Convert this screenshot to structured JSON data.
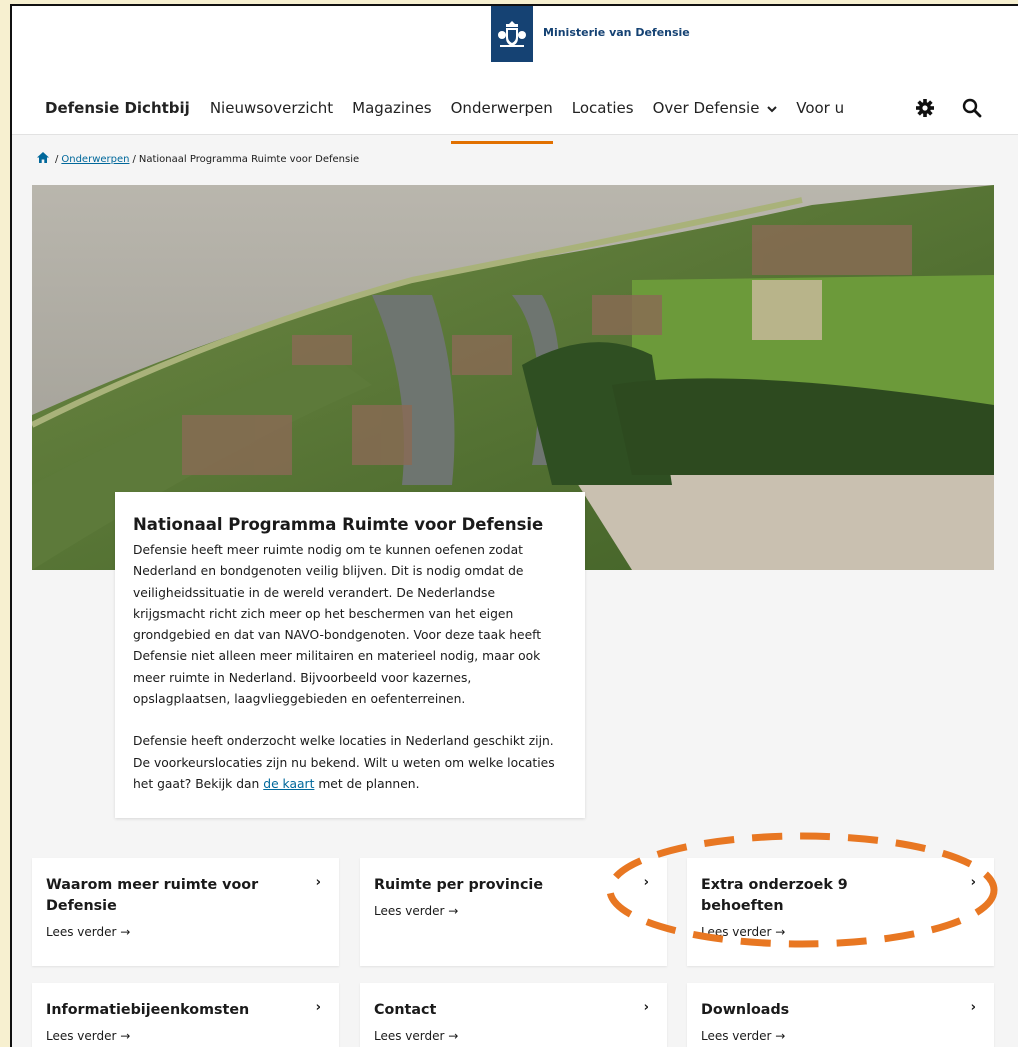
{
  "header": {
    "ministry": "Ministerie van Defensie",
    "nav": {
      "brand": "Defensie Dichtbij",
      "items": [
        "Nieuwsoverzicht",
        "Magazines",
        "Onderwerpen",
        "Locaties",
        "Over Defensie",
        "Voor u"
      ],
      "active": "Onderwerpen"
    },
    "icons": [
      "gear-icon",
      "search-icon",
      "chevron-down-icon"
    ]
  },
  "breadcrumb": {
    "home_icon": "home-icon",
    "link": "Onderwerpen",
    "current": "Nationaal Programma Ruimte voor Defensie",
    "separator": "/"
  },
  "intro": {
    "title": "Nationaal Programma Ruimte voor Defensie",
    "p1": "Defensie heeft meer ruimte nodig om te kunnen oefenen zodat Nederland en bondgenoten veilig blijven. Dit is nodig omdat de veiligheidssituatie in de wereld verandert. De Nederlandse krijgsmacht richt zich meer op het beschermen van het eigen grondgebied en dat van NAVO-bondgenoten. Voor deze taak heeft Defensie niet alleen meer militairen en materieel nodig, maar ook meer ruimte in Nederland. Bijvoorbeeld voor kazernes, opslagplaatsen, laagvlieggebieden en oefenterreinen.",
    "p2_before": "Defensie heeft onderzocht welke locaties in Nederland geschikt zijn. De voorkeurslocaties zijn nu bekend. Wilt u weten om welke locaties het gaat? Bekijk dan ",
    "p2_link": "de kaart",
    "p2_after": " met de plannen."
  },
  "cards": [
    {
      "title": "Waarom meer ruimte voor Defensie",
      "more": "Lees verder →",
      "arrow": "›"
    },
    {
      "title": "Ruimte per provincie",
      "more": "Lees verder →",
      "arrow": "›"
    },
    {
      "title": "Extra onderzoek 9 behoeften",
      "more": "Lees verder →",
      "arrow": "›"
    },
    {
      "title": "Informatiebijeenkomsten",
      "more": "Lees verder →",
      "arrow": "›"
    },
    {
      "title": "Contact",
      "more": "Lees verder →",
      "arrow": "›"
    },
    {
      "title": "Downloads",
      "more": "Lees verder →",
      "arrow": "›"
    }
  ],
  "colors": {
    "accent": "#e17000",
    "link": "#01689b",
    "ministry_blue": "#154273",
    "annotation": "#e87722"
  }
}
